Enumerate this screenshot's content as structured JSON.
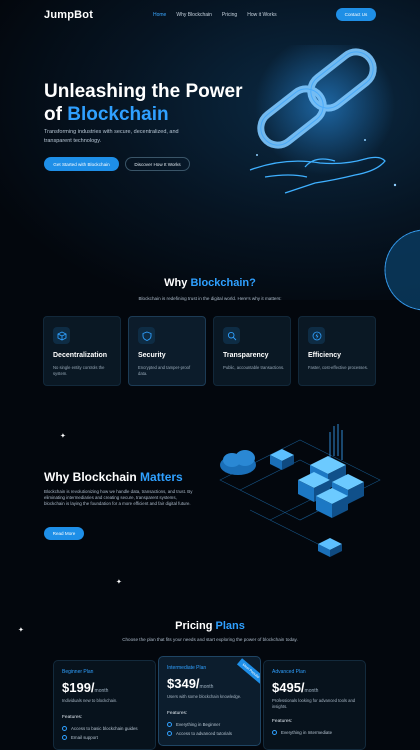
{
  "nav": {
    "logo": "JumpBot",
    "links": [
      "Home",
      "Why Blockchain",
      "Pricing",
      "How it Works"
    ],
    "contact": "Contact Us"
  },
  "hero": {
    "title_line1": "Unleashing the Power",
    "title_prefix": "of ",
    "title_highlight": "Blockchain",
    "subtitle": "Transforming industries with secure, decentralized, and transparent technology.",
    "primary_button": "Get Started with Blockchain",
    "secondary_button": "Discover How It Works"
  },
  "why": {
    "title_prefix": "Why ",
    "title_highlight": "Blockchain?",
    "subtitle": "Blockchain is redefining trust in the digital world. Here's why it matters:",
    "cards": [
      {
        "icon": "cube-icon",
        "title": "Decentralization",
        "desc": "No single entity controls the system."
      },
      {
        "icon": "shield-icon",
        "title": "Security",
        "desc": "Encrypted and tamper-proof data."
      },
      {
        "icon": "search-icon",
        "title": "Transparency",
        "desc": "Public, accountable transactions."
      },
      {
        "icon": "bolt-icon",
        "title": "Efficiency",
        "desc": "Faster, cost-effective processes."
      }
    ]
  },
  "matters": {
    "title_prefix": "Why Blockchain ",
    "title_highlight": "Matters",
    "text": "Blockchain is revolutionizing how we handle data, transactions, and trust. By eliminating intermediaries and creating secure, transparent systems, blockchain is laying the foundation for a more efficient and fair digital future.",
    "button": "Read More"
  },
  "pricing": {
    "title_prefix": "Pricing ",
    "title_highlight": "Plans",
    "subtitle": "Choose the plan that fits your needs and start exploring the power of blockchain today.",
    "features_label": "Features:",
    "plans": [
      {
        "name": "Beginner Plan",
        "price": "$199/",
        "per": "month",
        "desc": "Individuals new to blockchain.",
        "features": [
          "Access to basic blockchain guides",
          "Email support"
        ]
      },
      {
        "name": "Intermediate Plan",
        "price": "$349/",
        "per": "month",
        "desc": "Users with some blockchain knowledge.",
        "badge": "Most Popular",
        "features": [
          "Everything in Beginner",
          "Access to advanced tutorials"
        ]
      },
      {
        "name": "Advanced Plan",
        "price": "$495/",
        "per": "month",
        "desc": "Professionals looking for advanced tools and insights.",
        "features": [
          "Everything in Intermediate"
        ]
      }
    ]
  },
  "colors": {
    "accent": "#2fa0ff",
    "button": "#1e8fe8",
    "background": "#03070d"
  }
}
